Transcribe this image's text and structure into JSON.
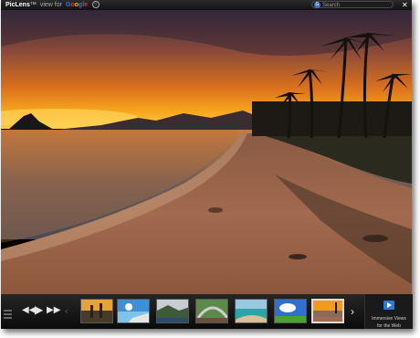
{
  "app": {
    "brand": "PicLens",
    "trademark": "™",
    "view_for": "view for",
    "provider_logo": [
      "G",
      "o",
      "o",
      "g",
      "l",
      "e"
    ]
  },
  "search": {
    "placeholder": "Search",
    "icon": "google-g-icon"
  },
  "controls": {
    "list_icon": "list-view-icon",
    "rewind_icon": "rewind-icon",
    "play_icon": "play-icon",
    "forward_icon": "fast-forward-icon",
    "prev_icon": "chevron-left-icon",
    "next_icon": "chevron-right-icon",
    "close_icon": "close-icon"
  },
  "thumbnails": [
    {
      "name": "thumbnail-1",
      "selected": false
    },
    {
      "name": "thumbnail-2",
      "selected": false
    },
    {
      "name": "thumbnail-3",
      "selected": false
    },
    {
      "name": "thumbnail-4",
      "selected": false
    },
    {
      "name": "thumbnail-5",
      "selected": false
    },
    {
      "name": "thumbnail-6",
      "selected": false
    },
    {
      "name": "thumbnail-7",
      "selected": true
    }
  ],
  "immersive": {
    "line1": "Immersive Views",
    "line2": "for the Web"
  },
  "colors": {
    "accent": "#2d7bd8",
    "sky_top": "#3a2a3c",
    "sunset": "#f29a1e"
  }
}
